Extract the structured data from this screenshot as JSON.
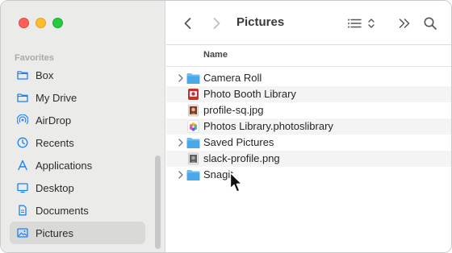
{
  "window": {
    "title": "Pictures"
  },
  "sidebar": {
    "section_heading": "Favorites",
    "items": [
      {
        "label": "Box",
        "icon": "folder-icon"
      },
      {
        "label": "My Drive",
        "icon": "folder-icon"
      },
      {
        "label": "AirDrop",
        "icon": "airdrop-icon"
      },
      {
        "label": "Recents",
        "icon": "clock-icon"
      },
      {
        "label": "Applications",
        "icon": "applications-icon"
      },
      {
        "label": "Desktop",
        "icon": "desktop-icon"
      },
      {
        "label": "Documents",
        "icon": "document-icon"
      },
      {
        "label": "Pictures",
        "icon": "pictures-icon",
        "selected": true
      }
    ]
  },
  "columns": {
    "name": "Name"
  },
  "files": [
    {
      "name": "Camera Roll",
      "kind": "folder",
      "expandable": true
    },
    {
      "name": "Photo Booth Library",
      "kind": "photobooth",
      "expandable": false
    },
    {
      "name": "profile-sq.jpg",
      "kind": "image",
      "expandable": false
    },
    {
      "name": "Photos Library.photoslibrary",
      "kind": "photos",
      "expandable": false
    },
    {
      "name": "Saved Pictures",
      "kind": "folder",
      "expandable": true
    },
    {
      "name": "slack-profile.png",
      "kind": "image",
      "expandable": false
    },
    {
      "name": "Snagit",
      "kind": "folder",
      "expandable": true
    }
  ],
  "colors": {
    "accent": "#1a82f7",
    "folder_blue": "#5ab7f2",
    "sidebar_bg": "#ebebea",
    "selected_bg": "#d9d9d8"
  }
}
